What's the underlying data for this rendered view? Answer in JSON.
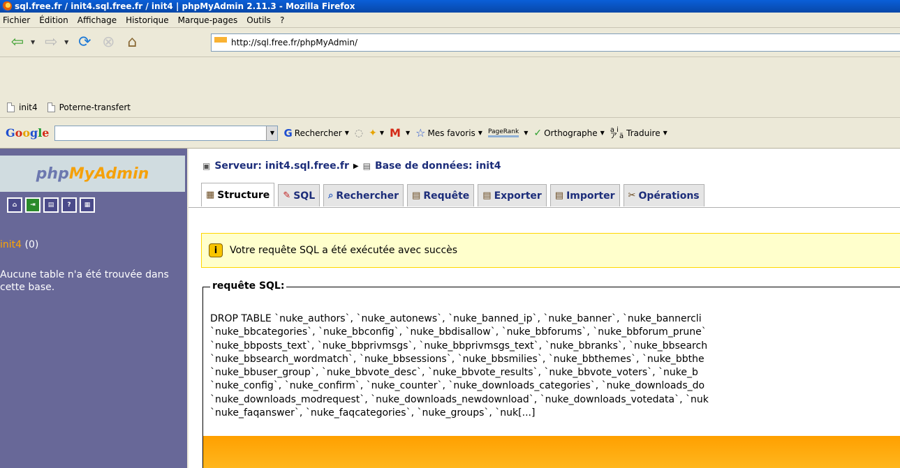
{
  "window": {
    "title": "sql.free.fr / init4.sql.free.fr / init4 | phpMyAdmin 2.11.3 - Mozilla Firefox"
  },
  "menu": [
    "Fichier",
    "Édition",
    "Affichage",
    "Historique",
    "Marque-pages",
    "Outils",
    "?"
  ],
  "nav": {
    "url": "http://sql.free.fr/phpMyAdmin/"
  },
  "bookmarks": [
    "init4",
    "Poterne-transfert"
  ],
  "google_toolbar": {
    "logo": "Google",
    "search_value": "",
    "search_label": "Rechercher",
    "favorites_label": "Mes favoris",
    "pagerank_label": "PageRank",
    "spelling_label": "Orthographe",
    "translate_label": "Traduire"
  },
  "sidebar": {
    "logo_php": "php",
    "logo_myadmin": "MyAdmin",
    "icons": [
      "home-icon",
      "exit-icon",
      "sql-query-icon",
      "help-icon",
      "query-window-icon"
    ],
    "db_name": "init4",
    "db_count": "(0)",
    "no_tables_msg": "Aucune table n'a été trouvée dans cette base."
  },
  "breadcrumb": {
    "server": "Serveur: init4.sql.free.fr",
    "database": "Base de données: init4"
  },
  "tabs": [
    "Structure",
    "SQL",
    "Rechercher",
    "Requête",
    "Exporter",
    "Importer",
    "Opérations"
  ],
  "notice": {
    "message": "Votre requête SQL a été exécutée avec succès"
  },
  "sql_box": {
    "legend": "requête SQL:",
    "lines": [
      "DROP TABLE `nuke_authors`, `nuke_autonews`, `nuke_banned_ip`, `nuke_banner`, `nuke_bannercli",
      "`nuke_bbcategories`, `nuke_bbconfig`, `nuke_bbdisallow`, `nuke_bbforums`, `nuke_bbforum_prune`",
      "`nuke_bbposts_text`, `nuke_bbprivmsgs`, `nuke_bbprivmsgs_text`, `nuke_bbranks`, `nuke_bbsearch",
      "`nuke_bbsearch_wordmatch`, `nuke_bbsessions`, `nuke_bbsmilies`, `nuke_bbthemes`, `nuke_bbthe",
      "`nuke_bbuser_group`, `nuke_bbvote_desc`, `nuke_bbvote_results`, `nuke_bbvote_voters`, `nuke_b",
      "`nuke_config`, `nuke_confirm`, `nuke_counter`, `nuke_downloads_categories`, `nuke_downloads_do",
      "`nuke_downloads_modrequest`, `nuke_downloads_newdownload`, `nuke_downloads_votedata`, `nuk",
      "`nuke_faqanswer`, `nuke_faqcategories`, `nuke_groups`, `nuk[...]"
    ]
  }
}
